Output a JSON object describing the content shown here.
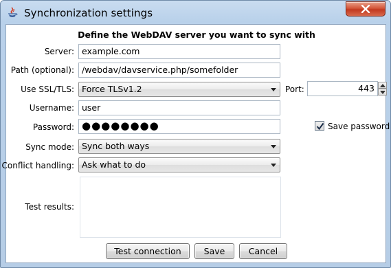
{
  "window": {
    "title": "Synchronization settings"
  },
  "form": {
    "heading": "Define the WebDAV server you want to sync with",
    "server": {
      "label": "Server:",
      "value": "example.com"
    },
    "path": {
      "label": "Path (optional):",
      "value": "/webdav/davservice.php/somefolder"
    },
    "ssl": {
      "label": "Use SSL/TLS:",
      "value": "Force TLSv1.2"
    },
    "port": {
      "label": "Port:",
      "value": "443"
    },
    "username": {
      "label": "Username:",
      "value": "user"
    },
    "password": {
      "label": "Password:",
      "value": "●●●●●●●●"
    },
    "save_password": {
      "label": "Save password",
      "checked": true
    },
    "sync_mode": {
      "label": "Sync mode:",
      "value": "Sync both ways"
    },
    "conflict": {
      "label": "Conflict handling:",
      "value": "Ask what to do"
    },
    "test_results": {
      "label": "Test results:",
      "value": ""
    }
  },
  "buttons": {
    "test_connection": "Test connection",
    "save": "Save",
    "cancel": "Cancel"
  },
  "colors": {
    "title_bar": "#b9d1ea",
    "close_button": "#c2391f"
  }
}
